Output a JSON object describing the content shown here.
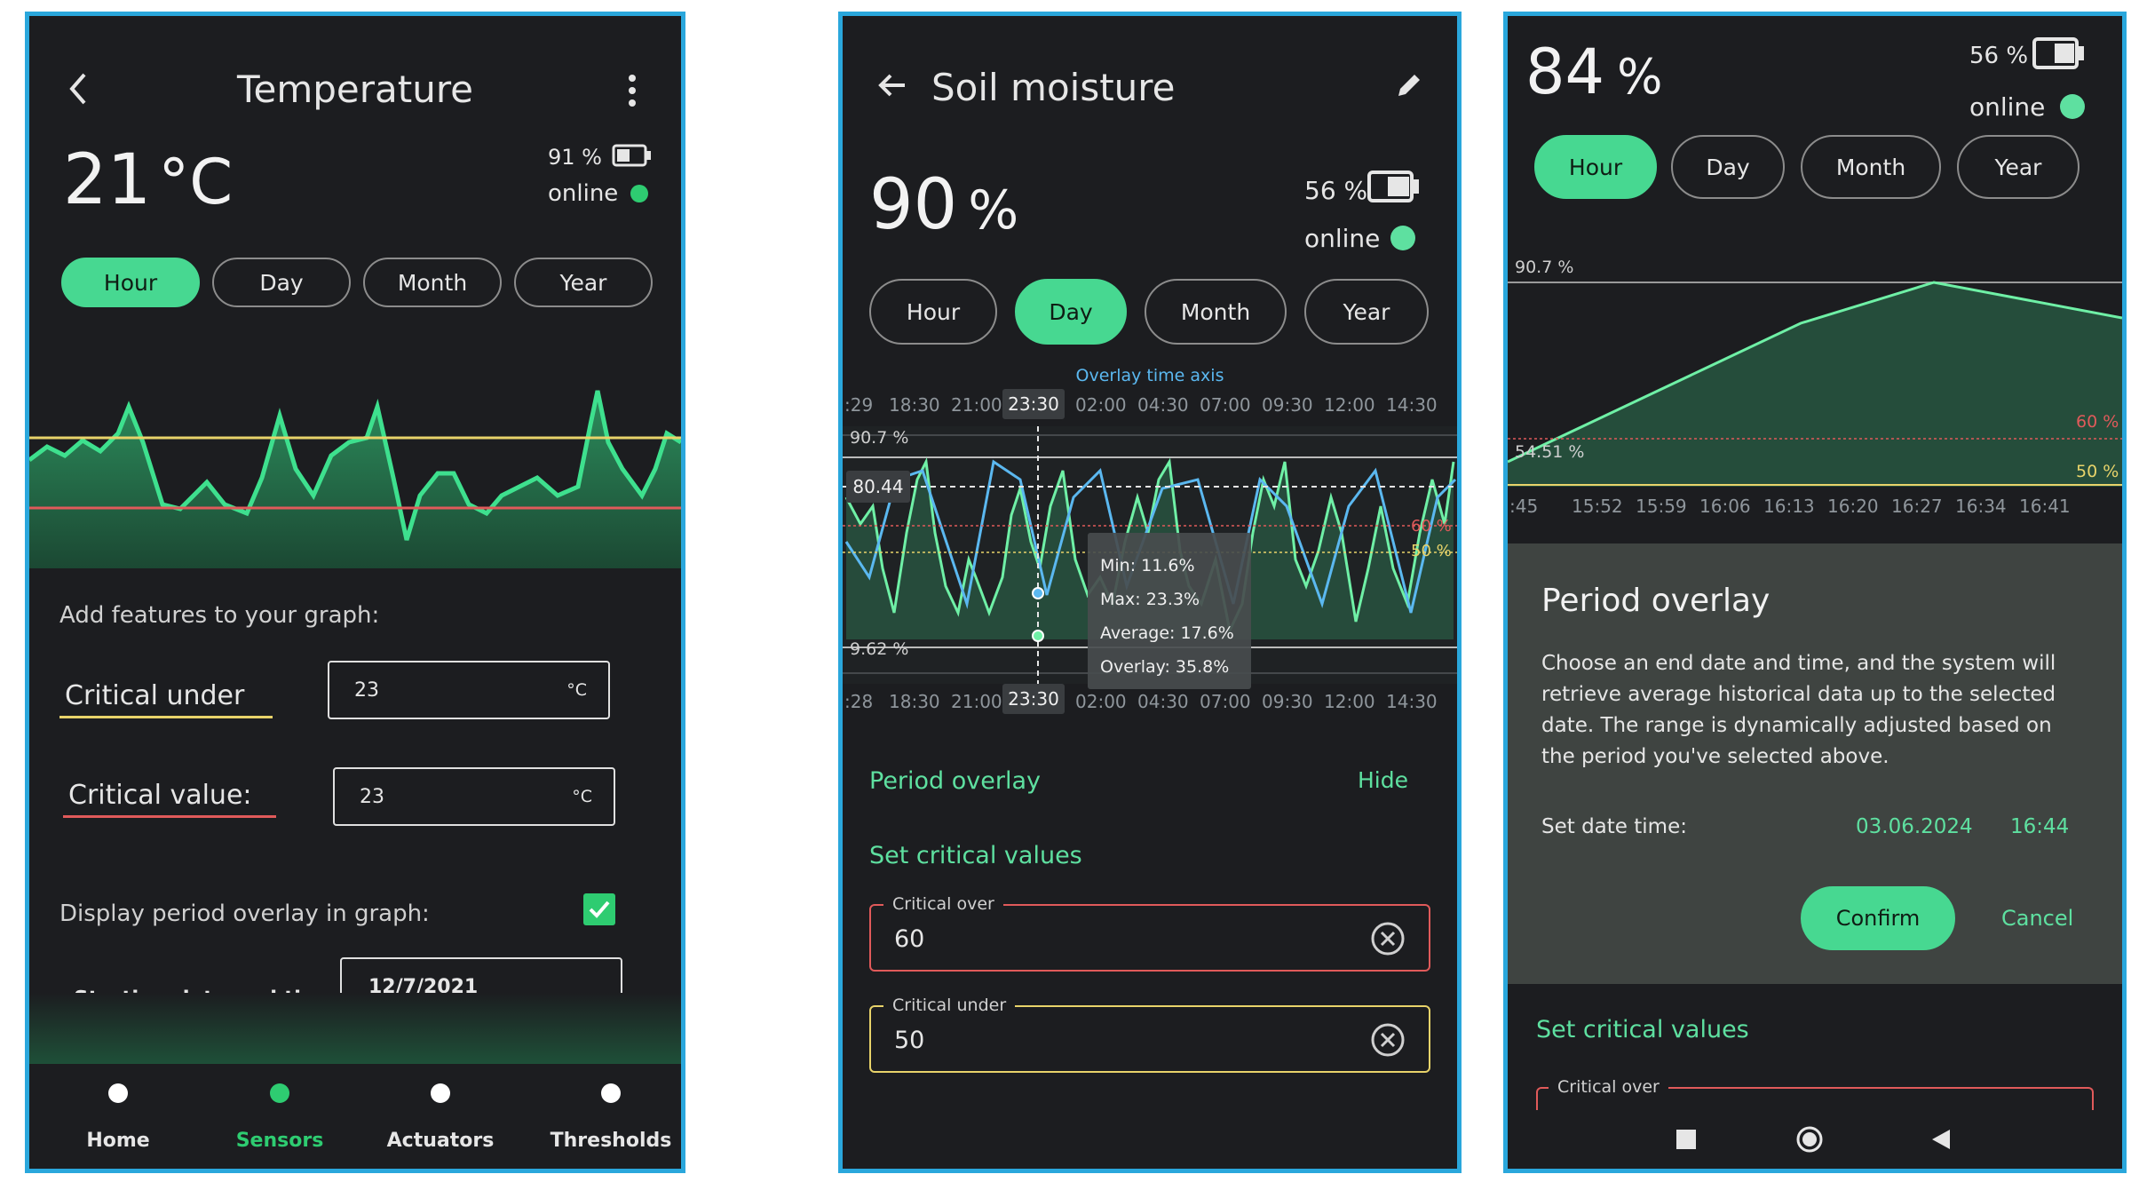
{
  "screens": [
    {
      "title": "Temperature",
      "value": "21",
      "unit": "°C",
      "battery": "91 %",
      "status": "online",
      "periods": [
        "Hour",
        "Day",
        "Month",
        "Year"
      ],
      "active_period": "Hour",
      "features_heading": "Add features to your graph:",
      "critical_under_label": "Critical under",
      "critical_under_value": "23",
      "critical_under_unit": "°C",
      "critical_value_label": "Critical value:",
      "critical_value_value": "23",
      "critical_value_unit": "°C",
      "overlay_label": "Display period overlay in graph:",
      "start_label": "Starting date and time:",
      "start_value": "12/7/2021",
      "nav": [
        "Home",
        "Sensors",
        "Actuators",
        "Thresholds"
      ],
      "active_nav": "Sensors"
    },
    {
      "title": "Soil moisture",
      "value": "90",
      "unit": "%",
      "battery": "56 %",
      "status": "online",
      "periods": [
        "Hour",
        "Day",
        "Month",
        "Year"
      ],
      "active_period": "Day",
      "overlay_axis_label": "Overlay time axis",
      "top_ticks": [
        ":29",
        "18:30",
        "21:00",
        "23:30",
        "02:00",
        "04:30",
        "07:00",
        "09:30",
        "12:00",
        "14:30"
      ],
      "bottom_ticks": [
        ":28",
        "18:30",
        "21:00",
        "23:30",
        "02:00",
        "04:30",
        "07:00",
        "09:30",
        "12:00",
        "14:30"
      ],
      "y_max_label": "90.7 %",
      "y_min_label": "9.62 %",
      "crosshair_value": "80.44",
      "line_60": "60 %",
      "line_50": "50 %",
      "tooltip": [
        "Min: 11.6%",
        "Max: 23.3%",
        "Average: 17.6%",
        "Overlay: 35.8%"
      ],
      "period_overlay": "Period overlay",
      "hide": "Hide",
      "set_critical": "Set critical values",
      "critical_over_label": "Critical over",
      "critical_over_value": "60",
      "critical_under_label": "Critical under",
      "critical_under_value": "50"
    },
    {
      "value": "84",
      "unit": "%",
      "battery": "56 %",
      "status": "online",
      "periods": [
        "Hour",
        "Day",
        "Month",
        "Year"
      ],
      "active_period": "Hour",
      "y_max_label": "90.7 %",
      "y_min_label": "54.51 %",
      "line_60": "60 %",
      "line_50": "50 %",
      "x_ticks": [
        ":45",
        "15:52",
        "15:59",
        "16:06",
        "16:13",
        "16:20",
        "16:27",
        "16:34",
        "16:41"
      ],
      "dialog_title": "Period overlay",
      "dialog_text": "Choose an end date and time, and the system will retrieve average historical data up to the selected date. The range is dynamically adjusted based on the period you've selected above.",
      "set_date_label": "Set date time:",
      "date": "03.06.2024",
      "time": "16:44",
      "confirm": "Confirm",
      "cancel": "Cancel",
      "set_critical": "Set critical values",
      "critical_over_label": "Critical over"
    }
  ],
  "colors": {
    "accent": "#47d891",
    "background": "#1c1d20",
    "critical_over": "#e05a5a",
    "critical_under": "#e8d36a",
    "series_blue": "#5bb8f0",
    "frame": "#2aa7dc"
  },
  "icons": [
    "back-icon",
    "more-vert-icon",
    "battery-icon",
    "edit-icon",
    "clear-icon",
    "check-icon",
    "stop-icon",
    "home-circle-icon",
    "back-triangle-icon"
  ]
}
